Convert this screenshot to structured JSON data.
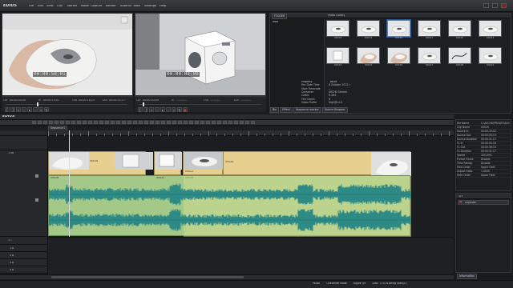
{
  "app": {
    "name": "EDIUS",
    "menu": [
      "File",
      "Edit",
      "View",
      "Clip",
      "Marker",
      "Mode",
      "Capture",
      "Render",
      "Autorun",
      "Tools",
      "Settings",
      "Help"
    ]
  },
  "player": {
    "timecode": "00:00:50:01",
    "cur_label": "Cur",
    "cur_value": "00:00:00;00",
    "in_label": "In",
    "in_value": "00:00:19;02",
    "out_label": "Out",
    "out_value": "00:00:16;25",
    "dur_label": "Dur",
    "dur_value": "00:00:31;17"
  },
  "recorder": {
    "timecode": "00:00:03:09",
    "cur_label": "Cur",
    "cur_value": "00:00:03;09",
    "in_label": "In",
    "in_value": "--:--:--;--",
    "out_label": "Out",
    "out_value": "--:--:--;--",
    "dur_label": "Dur",
    "dur_value": "--:--:--;--"
  },
  "bin": {
    "tab": "FOLDER",
    "path": "Photo Library",
    "folder": "Root",
    "thumbs": [
      {
        "name": "00018",
        "kind": "mouse",
        "selected": false
      },
      {
        "name": "00019",
        "kind": "mouse",
        "selected": false
      },
      {
        "name": "00020",
        "kind": "mouse",
        "selected": true
      },
      {
        "name": "00021",
        "kind": "mouse",
        "selected": false
      },
      {
        "name": "00022",
        "kind": "mouse",
        "selected": false
      },
      {
        "name": "00023",
        "kind": "mouse",
        "selected": false
      },
      {
        "name": "00024",
        "kind": "box",
        "selected": false
      },
      {
        "name": "00025",
        "kind": "hand",
        "selected": false
      },
      {
        "name": "00026",
        "kind": "hand",
        "selected": false
      },
      {
        "name": "00027",
        "kind": "mouse",
        "selected": false
      },
      {
        "name": "00028",
        "kind": "cable",
        "selected": false
      },
      {
        "name": "00029",
        "kind": "mouse",
        "selected": false
      }
    ],
    "properties_header": [
      "Property",
      "Value"
    ],
    "properties": [
      [
        "Rec Date Time",
        "8 October 2012 r."
      ],
      [
        "Start Timecode",
        "--"
      ],
      [
        "Container",
        "AVCHD Stream"
      ],
      [
        "Codec",
        "H.264"
      ],
      [
        "YUV Depth",
        "8"
      ],
      [
        "Video Profile",
        "High@L4.0"
      ]
    ],
    "bottom_tabs": [
      "Bin",
      "Effect",
      "Sequence marker",
      "Source Browser"
    ]
  },
  "timeline": {
    "header": "EDIUS",
    "sequence_tab": "Sequence1",
    "tracks": [
      {
        "name": "1 VA",
        "type": "video"
      },
      {
        "name": "1 A",
        "type": "audio"
      },
      {
        "name": "2 A",
        "type": "audio"
      },
      {
        "name": "3 A",
        "type": "audio"
      },
      {
        "name": "4 A",
        "type": "audio"
      }
    ],
    "tt_label": "1 T",
    "clips": [
      {
        "label": "00018"
      },
      {
        "label": "00026"
      },
      {
        "label": "00022"
      },
      {
        "label": "00026"
      }
    ],
    "audio_labels": [
      "00026",
      "00022",
      "00026"
    ]
  },
  "info": {
    "title": "Information",
    "rows": [
      [
        "File Name",
        "C:\\AVCHD\\PRIVATE\\AVCHD\\BDMV\\STREAM\\00026.MTS"
      ],
      [
        "Clip Name",
        "00026"
      ],
      [
        "Source In",
        "00:00:19:02"
      ],
      [
        "Source Out",
        "00:00:50:19"
      ],
      [
        "Source Duration",
        "00:00:31:17"
      ],
      [
        "TL In",
        "00:00:04:18"
      ],
      [
        "TL Out",
        "00:00:36:10"
      ],
      [
        "TL Duration",
        "00:00:31:17"
      ],
      [
        "Speed",
        "100.00%"
      ],
      [
        "Freeze Frame",
        "Disable"
      ],
      [
        "Time Remap",
        "Disable"
      ],
      [
        "Field Order",
        "Upper Field"
      ],
      [
        "Aspect Ratio",
        "1.0000"
      ],
      [
        "Field Order",
        "Upper Field"
      ]
    ],
    "layer_tab": "1/1",
    "layer_item": "Layouter"
  },
  "status": {
    "items": [
      "Pause",
      "Overwrite Mode",
      "Ripple Off",
      "Disk: 71% is being used(C:)"
    ]
  },
  "colors": {
    "accent": "#4a8ad9",
    "clip_video": "#e6cf8f",
    "clip_audio": "#a3c887",
    "waveform": "#2d8a85"
  }
}
